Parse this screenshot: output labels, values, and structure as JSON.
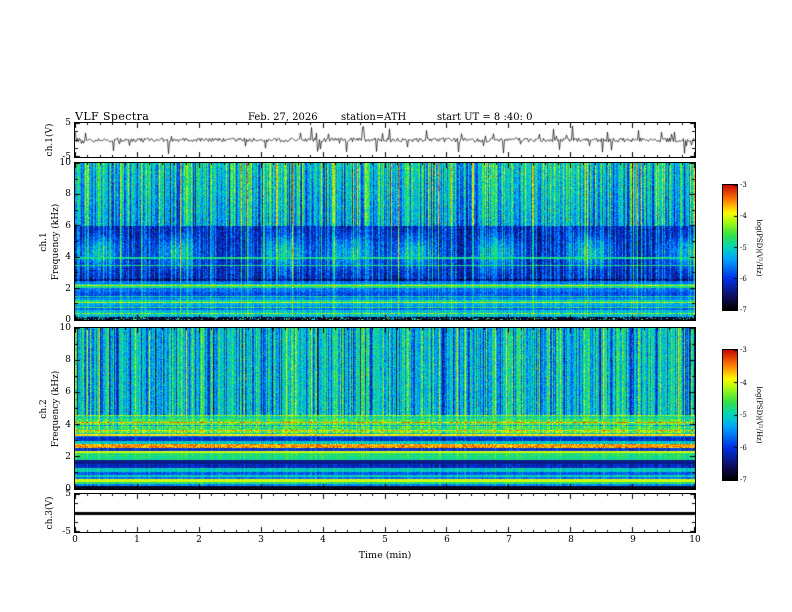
{
  "header": {
    "title": "VLF Spectra",
    "date": "Feb. 27, 2026",
    "station": "station=ATH",
    "start_ut": "start UT =  8 :40: 0"
  },
  "xaxis": {
    "label": "Time (min)",
    "range": [
      0,
      10
    ],
    "ticks": [
      0,
      1,
      2,
      3,
      4,
      5,
      6,
      7,
      8,
      9,
      10
    ],
    "minor_tick_interval": 0.2
  },
  "colorbars": [
    {
      "label": "log(PSD)(V²/Hz)",
      "ticks": [
        -3,
        -4,
        -5,
        -6,
        -7
      ],
      "range_top": -3,
      "range_bottom": -7,
      "colormap_top_to_bottom": [
        "red",
        "orange",
        "yellow",
        "green",
        "cyan",
        "blue",
        "black"
      ]
    },
    {
      "label": "log(PSD)(V²/Hz)",
      "ticks": [
        -3,
        -4,
        -5,
        -6,
        -7
      ],
      "range_top": -3,
      "range_bottom": -7,
      "colormap_top_to_bottom": [
        "red",
        "orange",
        "yellow",
        "green",
        "cyan",
        "blue",
        "black"
      ]
    }
  ],
  "chart_data": [
    {
      "type": "line",
      "name": "ch1_time_series",
      "ylabel_lines": [
        "ch.1(V)"
      ],
      "ylim": [
        -5,
        5
      ],
      "yticks": [
        5,
        -5
      ],
      "x_range": [
        0,
        10
      ],
      "description": "Broadband VLF receiver output: noise floor near 0 V with dense impulsive sferic spikes reaching about ±5 V"
    },
    {
      "type": "heatmap",
      "name": "ch1_spectrogram",
      "ylabel_lines": [
        "ch.1",
        "Frequency (kHz)"
      ],
      "ylim": [
        0,
        10
      ],
      "yticks": [
        0,
        2,
        4,
        6,
        8,
        10
      ],
      "x_range": [
        0,
        10
      ],
      "value_label": "log(PSD)(V²/Hz)",
      "value_range": [
        -7,
        -3
      ],
      "features": [
        "dense vertical sferic striations across all frequencies",
        "green-yellow high power above ~6 kHz with red bursts",
        "dark blue low-power band ~2.5-6 kHz with periodic green patches near 4 kHz",
        "narrow horizontal emission lines near 2.0, 3.4 and 3.9 kHz",
        "banded cyan/green power-line harmonics below 2.5 kHz",
        "near-black band at the very bottom (<0.2 kHz)"
      ]
    },
    {
      "type": "heatmap",
      "name": "ch2_spectrogram",
      "ylabel_lines": [
        "ch.2",
        "Frequency (kHz)"
      ],
      "ylim": [
        0,
        10
      ],
      "yticks": [
        0,
        2,
        4,
        6,
        8,
        10
      ],
      "x_range": [
        0,
        10
      ],
      "value_label": "log(PSD)(V²/Hz)",
      "value_range": [
        -7,
        -3
      ],
      "features": [
        "green background above ~4.5 kHz cut by dark blue vertical sferic striations",
        "bright yellow horizontal line near 3.3 kHz",
        "strong horizontal banding below ~3 kHz with yellow/orange/red harmonic lines",
        "near-black band at the very bottom (<0.15 kHz)"
      ]
    },
    {
      "type": "line",
      "name": "ch3_time_series",
      "ylabel_lines": [
        "ch.3(V)"
      ],
      "ylim": [
        -5,
        5
      ],
      "yticks": [
        5,
        -5
      ],
      "x_range": [
        0,
        10
      ],
      "description": "Flat constant trace near 0 V (channel inactive)"
    }
  ]
}
